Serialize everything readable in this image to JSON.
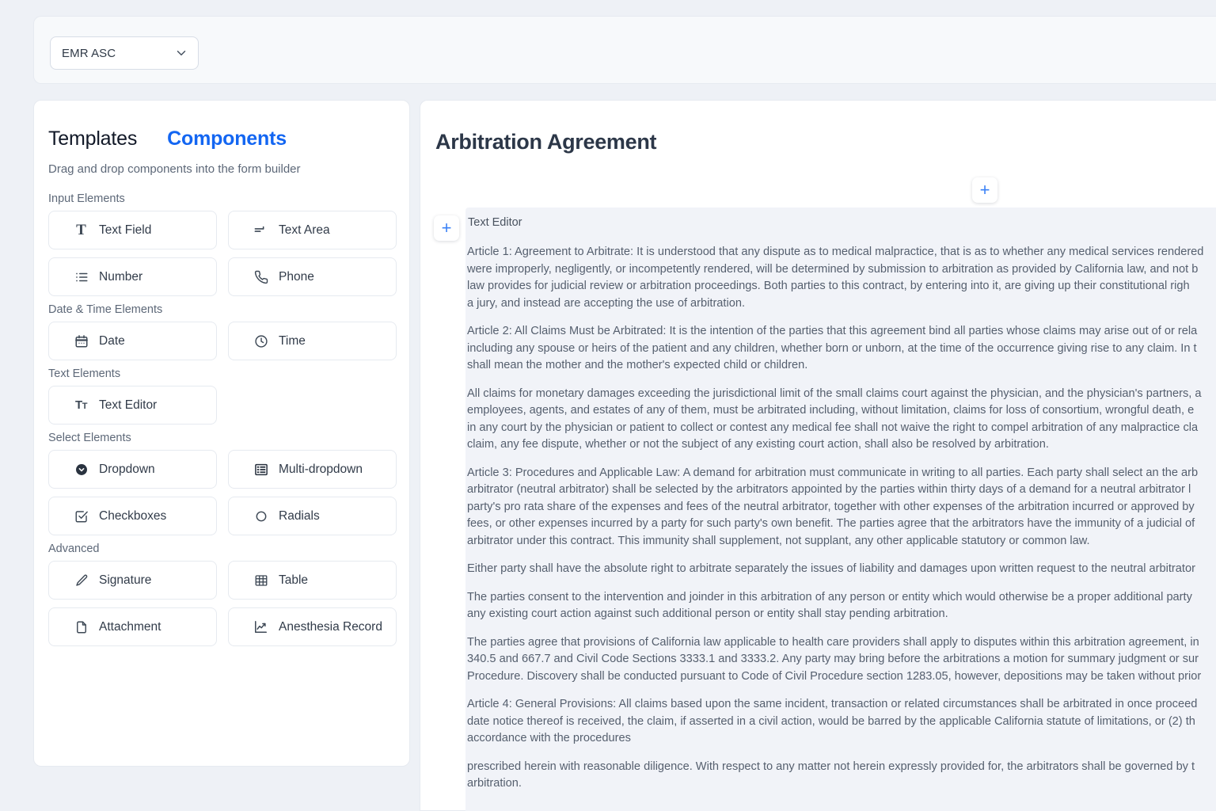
{
  "topbar": {
    "select": {
      "value": "EMR ASC",
      "icon": "chevron-down-icon"
    }
  },
  "sidebar": {
    "tabs": [
      {
        "label": "Templates",
        "active": false
      },
      {
        "label": "Components",
        "active": true
      }
    ],
    "subtitle": "Drag and drop components into the form builder",
    "accent_color": "#1366f2",
    "groups": [
      {
        "title": "Input Elements",
        "items": [
          {
            "label": "Text Field",
            "icon": "text-field-icon"
          },
          {
            "label": "Text Area",
            "icon": "text-area-icon"
          },
          {
            "label": "Number",
            "icon": "ordered-list-icon"
          },
          {
            "label": "Phone",
            "icon": "phone-icon"
          }
        ]
      },
      {
        "title": "Date & Time Elements",
        "items": [
          {
            "label": "Date",
            "icon": "calendar-icon"
          },
          {
            "label": "Time",
            "icon": "clock-icon"
          }
        ]
      },
      {
        "title": "Text Elements",
        "items": [
          {
            "label": "Text Editor",
            "icon": "text-editor-icon"
          }
        ]
      },
      {
        "title": "Select Elements",
        "items": [
          {
            "label": "Dropdown",
            "icon": "dropdown-icon"
          },
          {
            "label": "Multi-dropdown",
            "icon": "multi-dropdown-icon"
          },
          {
            "label": "Checkboxes",
            "icon": "checkbox-icon"
          },
          {
            "label": "Radials",
            "icon": "radio-icon"
          }
        ]
      },
      {
        "title": "Advanced",
        "items": [
          {
            "label": "Signature",
            "icon": "pencil-icon"
          },
          {
            "label": "Table",
            "icon": "table-icon"
          },
          {
            "label": "Attachment",
            "icon": "file-icon"
          },
          {
            "label": "Anesthesia Record",
            "icon": "chart-line-icon"
          }
        ]
      }
    ]
  },
  "canvas": {
    "title": "Arbitration Agreement",
    "add_button_label": "+",
    "block": {
      "label": "Text Editor",
      "paragraphs": [
        "Article 1: Agreement to Arbitrate: It is understood that any dispute as to medical malpractice, that is as to whether any medical services rendered\nwere improperly, negligently, or incompetently rendered, will be determined by submission to arbitration as provided by California law, and not b\nlaw provides for judicial review or arbitration proceedings. Both parties to this contract, by entering into it, are giving up their constitutional righ\na jury, and instead are accepting the use of arbitration.",
        "Article 2: All Claims Must be Arbitrated: It is the intention of the parties that this agreement bind all parties whose claims may arise out of or rela\nincluding any spouse or heirs of the patient and any children, whether born or unborn, at the time of the occurrence giving rise to any claim. In t\nshall mean the mother and the mother's expected child or children.",
        "All claims for monetary damages exceeding the jurisdictional limit of the small claims court against the physician, and the physician's partners, a\nemployees, agents, and estates of any of them, must be arbitrated including, without limitation, claims for loss of consortium, wrongful death, e\nin any court by the physician or patient to collect or contest any medical fee shall not waive the right to compel arbitration of any malpractice cla\nclaim, any fee dispute, whether or not the subject of any existing court action, shall also be resolved by arbitration.",
        "Article 3: Procedures and Applicable Law: A demand for arbitration must communicate in writing to all parties. Each party shall select an the arb\narbitrator (neutral arbitrator) shall be selected by the arbitrators appointed by the parties within thirty days of a demand for a neutral arbitrator l\nparty's pro rata share of the expenses and fees of the neutral arbitrator, together with other expenses of the arbitration incurred or approved by\nfees, or other expenses incurred by a party for such party's own benefit. The parties agree that the arbitrators have the immunity of a judicial of\narbitrator under this contract. This immunity shall supplement, not supplant, any other applicable statutory or common law.",
        "Either party shall have the absolute right to arbitrate separately the issues of liability and damages upon written request to the neutral arbitrator",
        "The parties consent to the intervention and joinder in this arbitration of any person or entity which would otherwise be a proper additional party\nany existing court action against such additional person or entity shall stay pending arbitration.",
        "The parties agree that provisions of California law applicable to health care providers shall apply to disputes within this arbitration agreement, in\n340.5 and 667.7 and Civil Code Sections 3333.1 and 3333.2. Any party may bring before the arbitrations a motion for summary judgment or sur\nProcedure. Discovery shall be conducted pursuant to Code of Civil Procedure section 1283.05, however, depositions may be taken without prior",
        "Article 4: General Provisions: All claims based upon the same incident, transaction or related circumstances shall be arbitrated in once proceed\ndate notice thereof is received, the claim, if asserted in a civil action, would be barred by the applicable California statute of limitations, or (2) th\naccordance with the procedures",
        "prescribed herein with reasonable diligence. With respect to any matter not herein expressly provided for, the arbitrators shall be governed by t\narbitration."
      ]
    }
  }
}
